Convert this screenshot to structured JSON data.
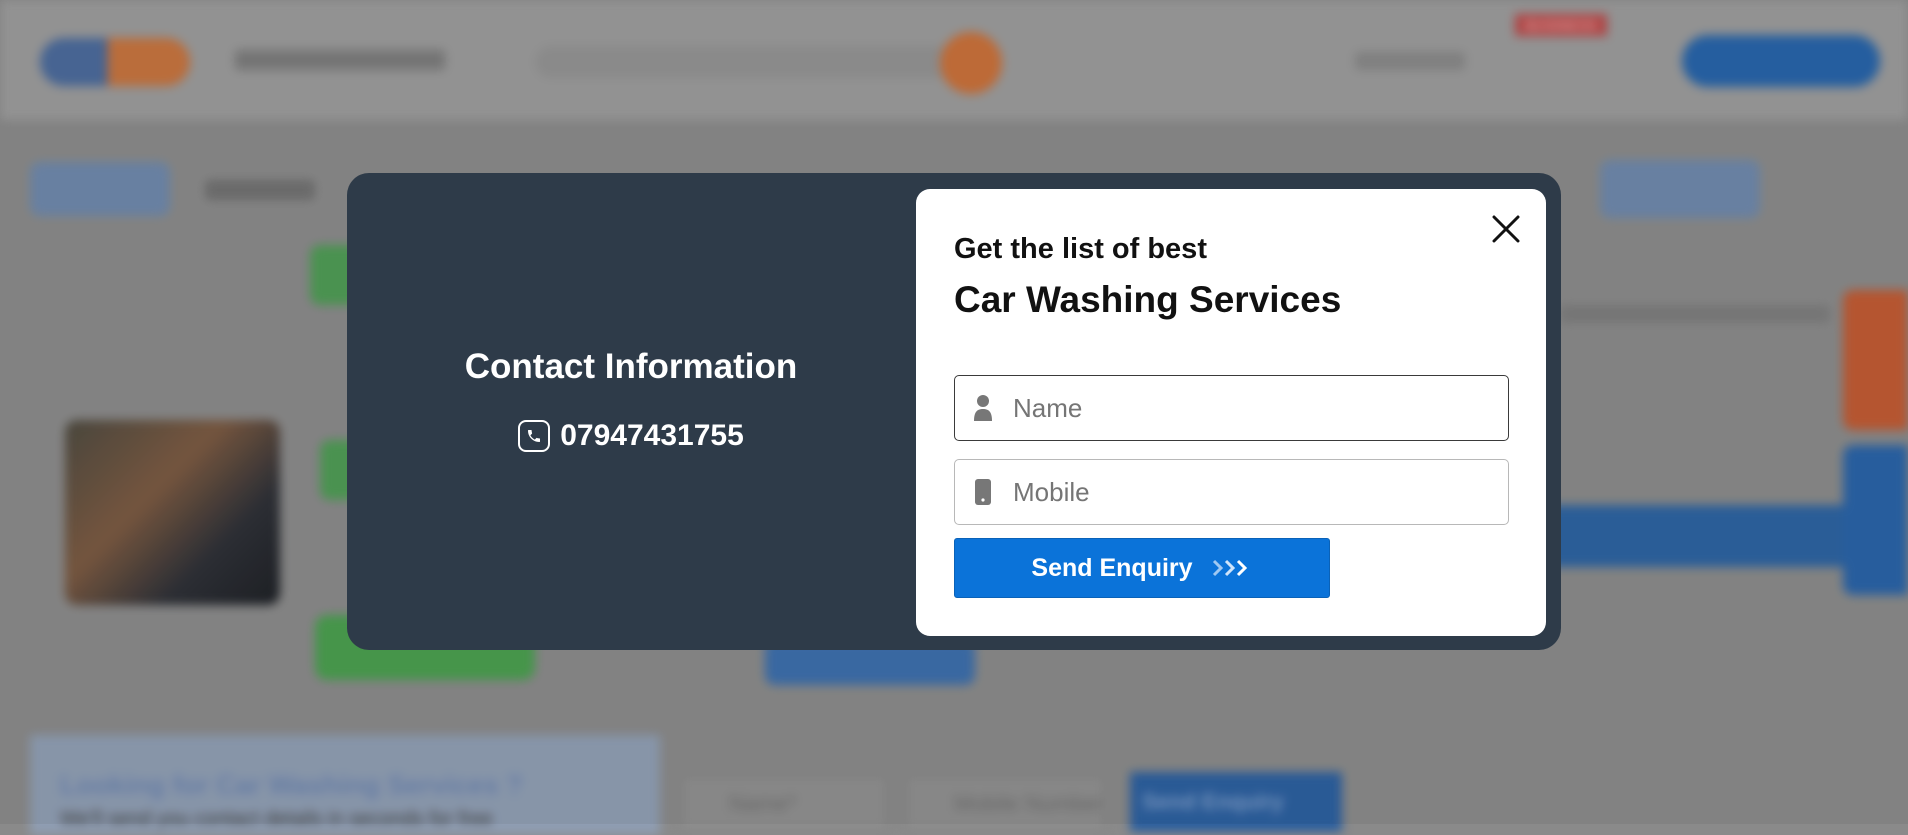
{
  "background": {
    "business_badge": "BUSINESS",
    "bottom_banner": {
      "title": "Looking for Car Washing Services ?",
      "subtitle": "We'll send you contact details in seconds for free",
      "name_placeholder": "Name*",
      "mobile_placeholder": "Mobile Number*",
      "send_label": "Send Enquiry"
    }
  },
  "modal": {
    "left": {
      "title": "Contact Information",
      "phone": "07947431755",
      "phone_icon": "phone-icon"
    },
    "form": {
      "heading_line1": "Get the list of best",
      "heading_line2": "Car Washing Services",
      "name_placeholder": "Name",
      "name_icon": "user-icon",
      "mobile_placeholder": "Mobile",
      "mobile_icon": "mobile-icon",
      "submit_label": "Send Enquiry",
      "submit_icon": "triple-chevron-right-icon",
      "close_icon": "close-icon"
    }
  },
  "colors": {
    "modal_dark": "#2e3b49",
    "button_blue": "#0b73d9",
    "card_white": "#ffffff",
    "text_dark": "#111111"
  }
}
